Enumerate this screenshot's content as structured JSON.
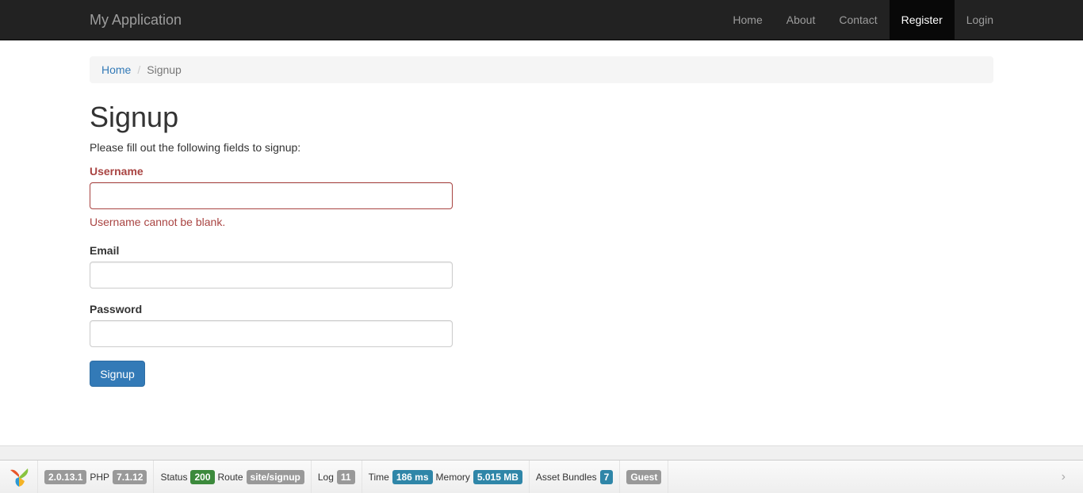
{
  "navbar": {
    "brand": "My Application",
    "items": [
      {
        "label": "Home"
      },
      {
        "label": "About"
      },
      {
        "label": "Contact"
      },
      {
        "label": "Register"
      },
      {
        "label": "Login"
      }
    ]
  },
  "breadcrumb": {
    "home": "Home",
    "separator": "/",
    "current": "Signup"
  },
  "page": {
    "title": "Signup",
    "intro": "Please fill out the following fields to signup:"
  },
  "form": {
    "username": {
      "label": "Username",
      "value": "",
      "error": "Username cannot be blank."
    },
    "email": {
      "label": "Email",
      "value": ""
    },
    "password": {
      "label": "Password",
      "value": ""
    },
    "submit": "Signup"
  },
  "debug": {
    "yii_version": "2.0.13.1",
    "php_label": "PHP",
    "php_version": "7.1.12",
    "status_label": "Status",
    "status": "200",
    "route_label": "Route",
    "route": "site/signup",
    "log_label": "Log",
    "log_count": "11",
    "time_label": "Time",
    "time": "186 ms",
    "memory_label": "Memory",
    "memory": "5.015 MB",
    "assets_label": "Asset Bundles",
    "assets_count": "7",
    "user": "Guest",
    "chevron": "›"
  },
  "colors": {
    "navbar_bg": "#222222",
    "primary": "#337ab7",
    "error": "#a94442"
  }
}
